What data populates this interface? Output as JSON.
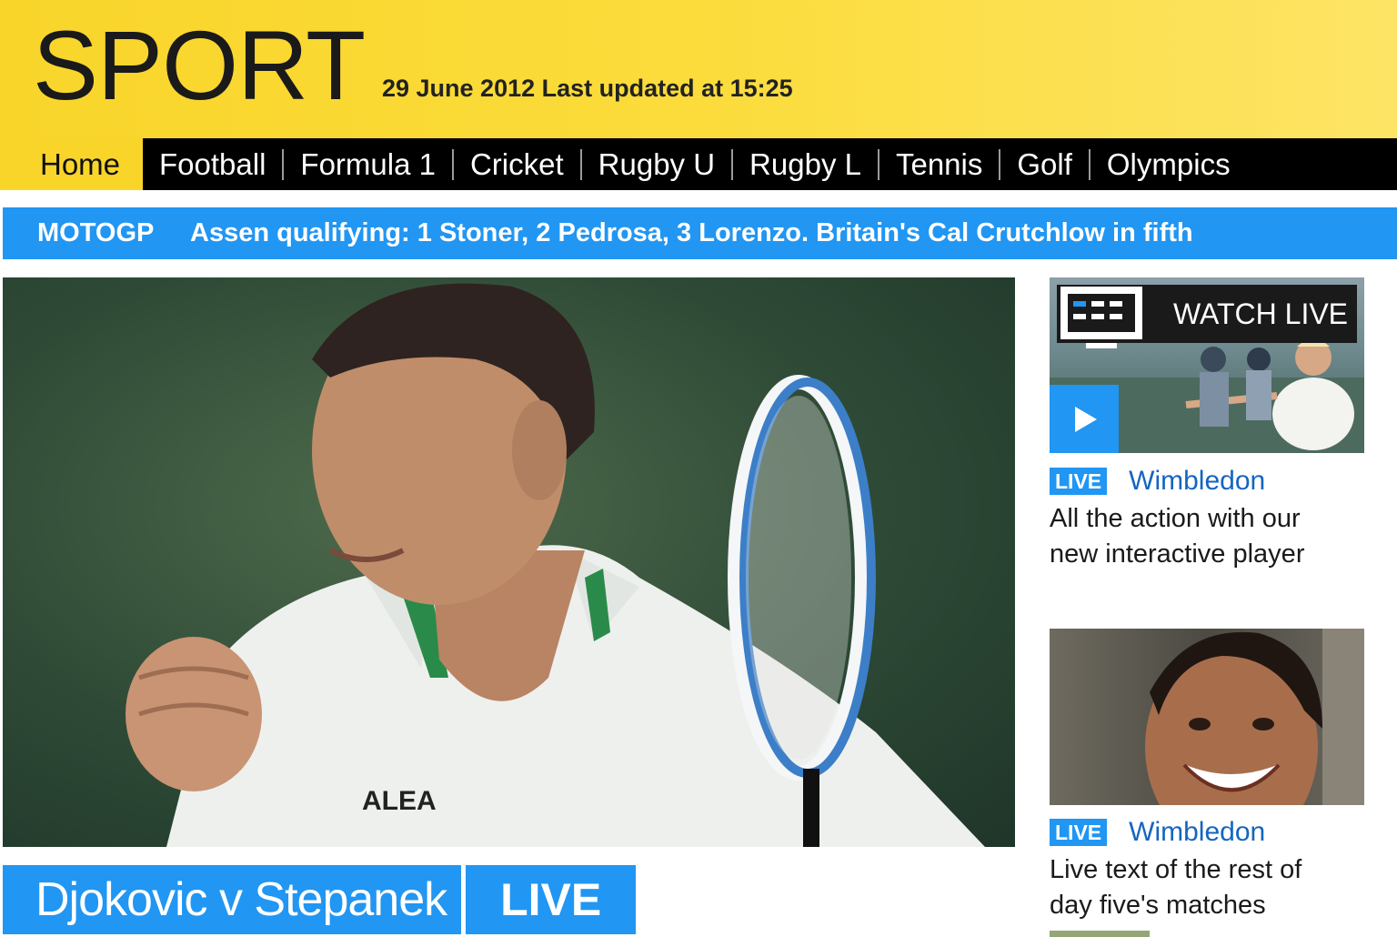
{
  "header": {
    "logo": "SPORT",
    "updated": "29 June 2012 Last updated at 15:25"
  },
  "nav": {
    "items": [
      "Home",
      "Football",
      "Formula 1",
      "Cricket",
      "Rugby U",
      "Rugby L",
      "Tennis",
      "Golf",
      "Olympics"
    ],
    "active": "Home"
  },
  "ticker": {
    "tag": "MOTOGP",
    "text": "Assen qualifying: 1 Stoner, 2 Pedrosa, 3 Lorenzo. Britain's Cal Crutchlow in fifth"
  },
  "hero": {
    "shirt_logo": "ALEA",
    "headline": "Djokovic v Stepanek",
    "status": "LIVE"
  },
  "sidebar": {
    "watch_label": "WATCH LIVE",
    "items": [
      {
        "badge": "LIVE",
        "title": "Wimbledon",
        "desc_line1": "All the action with our",
        "desc_line2": "new interactive player"
      },
      {
        "badge": "LIVE",
        "title": "Wimbledon",
        "desc_line1": "Live text of the rest of",
        "desc_line2": "day five's matches"
      }
    ]
  },
  "colors": {
    "header_yellow": "#f9d52a",
    "accent_blue": "#2196f3",
    "link_blue": "#1565c0",
    "nav_black": "#000000"
  },
  "icons": [
    "tv-icon",
    "play-icon"
  ]
}
